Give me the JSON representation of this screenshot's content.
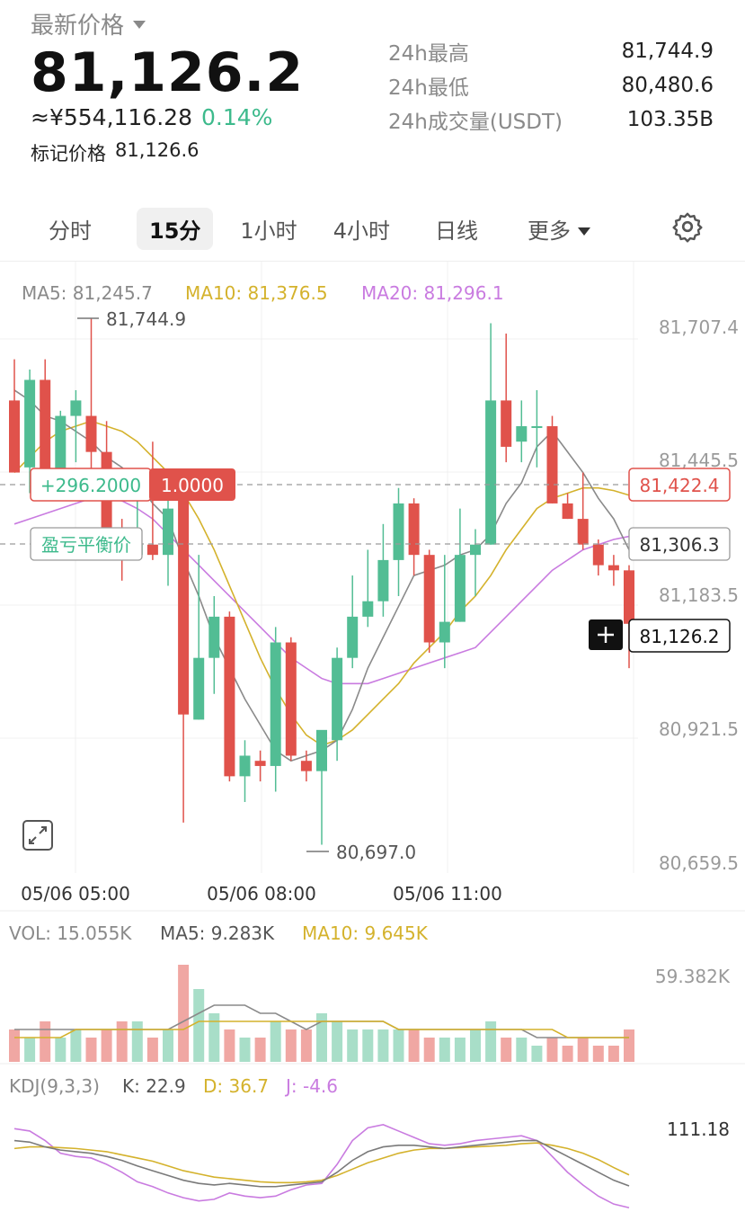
{
  "header": {
    "label": "最新价格",
    "price": "81,126.2",
    "cny_price": "≈¥554,116.28",
    "change_pct": "0.14%",
    "mark_label": "标记价格",
    "mark_value": "81,126.6"
  },
  "stats": [
    {
      "label": "24h最高",
      "value": "81,744.9"
    },
    {
      "label": "24h最低",
      "value": "80,480.6"
    },
    {
      "label": "24h成交量(USDT)",
      "value": "103.35B"
    }
  ],
  "tabs": [
    {
      "label": "分时",
      "active": false
    },
    {
      "label": "15分",
      "active": true
    },
    {
      "label": "1小时",
      "active": false
    },
    {
      "label": "4小时",
      "active": false
    },
    {
      "label": "日线",
      "active": false
    },
    {
      "label": "更多",
      "active": false
    }
  ],
  "icons": {
    "settings": "gear-icon",
    "more": "chevron-down-icon",
    "expand": "expand-icon",
    "crosshair": "plus-icon"
  },
  "colors": {
    "up": "#52bd94",
    "down": "#e0524b",
    "ma5": "#8a8a8a",
    "ma10": "#d4b22c",
    "ma20": "#c97be0"
  },
  "main_legend": {
    "ma5": "MA5: 81,245.7",
    "ma10": "MA10: 81,376.5",
    "ma20": "MA20: 81,296.1"
  },
  "price_axis": [
    "81,707.4",
    "81,445.5",
    "81,183.5",
    "80,921.5",
    "80,659.5"
  ],
  "time_axis": [
    "05/06 05:00",
    "05/06 08:00",
    "05/06 11:00"
  ],
  "annotations": {
    "high": "81,744.9",
    "low": "80,697.0",
    "position_pnl": "+296.2000",
    "position_qty": "1.0000",
    "position_price": "81,422.4",
    "breakeven_label": "盈亏平衡价",
    "breakeven_price": "81,306.3",
    "current_price": "81,126.2"
  },
  "vol_legend": {
    "vol": "VOL: 15.055K",
    "ma5": "MA5: 9.283K",
    "ma10": "MA10: 9.645K"
  },
  "vol_axis": "59.382K",
  "kdj_legend": {
    "name": "KDJ(9,3,3)",
    "k": "K: 22.9",
    "d": "D: 36.7",
    "j": "J: -4.6"
  },
  "kdj_axis": "111.18",
  "chart_data": {
    "type": "candlestick",
    "candles": [
      {
        "o": 81560,
        "h": 81640,
        "l": 81460,
        "c": 81420
      },
      {
        "o": 81430,
        "h": 81620,
        "l": 81380,
        "c": 81600
      },
      {
        "o": 81600,
        "h": 81640,
        "l": 81380,
        "c": 81400
      },
      {
        "o": 81400,
        "h": 81540,
        "l": 81370,
        "c": 81530
      },
      {
        "o": 81530,
        "h": 81580,
        "l": 81440,
        "c": 81560
      },
      {
        "o": 81530,
        "h": 81720,
        "l": 81380,
        "c": 81460
      },
      {
        "o": 81460,
        "h": 81520,
        "l": 81300,
        "c": 81310
      },
      {
        "o": 81310,
        "h": 81330,
        "l": 81210,
        "c": 81260
      },
      {
        "o": 81260,
        "h": 81390,
        "l": 81250,
        "c": 81280
      },
      {
        "o": 81280,
        "h": 81480,
        "l": 81250,
        "c": 81260
      },
      {
        "o": 81260,
        "h": 81420,
        "l": 81200,
        "c": 81350
      },
      {
        "o": 81370,
        "h": 81390,
        "l": 80740,
        "c": 80950
      },
      {
        "o": 80940,
        "h": 81260,
        "l": 80940,
        "c": 81060
      },
      {
        "o": 81060,
        "h": 81180,
        "l": 80990,
        "c": 81140
      },
      {
        "o": 81140,
        "h": 81150,
        "l": 80820,
        "c": 80830
      },
      {
        "o": 80830,
        "h": 80900,
        "l": 80780,
        "c": 80870
      },
      {
        "o": 80860,
        "h": 80880,
        "l": 80820,
        "c": 80850
      },
      {
        "o": 80850,
        "h": 81120,
        "l": 80800,
        "c": 81090
      },
      {
        "o": 81090,
        "h": 81100,
        "l": 80860,
        "c": 80870
      },
      {
        "o": 80860,
        "h": 80880,
        "l": 80820,
        "c": 80840
      },
      {
        "o": 80840,
        "h": 80900,
        "l": 80697,
        "c": 80920
      },
      {
        "o": 80900,
        "h": 81080,
        "l": 80860,
        "c": 81060
      },
      {
        "o": 81060,
        "h": 81220,
        "l": 81040,
        "c": 81140
      },
      {
        "o": 81140,
        "h": 81270,
        "l": 81120,
        "c": 81170
      },
      {
        "o": 81170,
        "h": 81320,
        "l": 81140,
        "c": 81250
      },
      {
        "o": 81250,
        "h": 81390,
        "l": 81180,
        "c": 81360
      },
      {
        "o": 81360,
        "h": 81370,
        "l": 81220,
        "c": 81260
      },
      {
        "o": 81260,
        "h": 81270,
        "l": 81070,
        "c": 81090
      },
      {
        "o": 81090,
        "h": 81260,
        "l": 81040,
        "c": 81130
      },
      {
        "o": 81130,
        "h": 81350,
        "l": 81130,
        "c": 81260
      },
      {
        "o": 81260,
        "h": 81310,
        "l": 81180,
        "c": 81280
      },
      {
        "o": 81280,
        "h": 81710,
        "l": 81280,
        "c": 81560
      },
      {
        "o": 81560,
        "h": 81690,
        "l": 81440,
        "c": 81470
      },
      {
        "o": 81480,
        "h": 81560,
        "l": 81440,
        "c": 81510
      },
      {
        "o": 81510,
        "h": 81580,
        "l": 81430,
        "c": 81510
      },
      {
        "o": 81510,
        "h": 81530,
        "l": 81360,
        "c": 81360
      },
      {
        "o": 81360,
        "h": 81380,
        "l": 81330,
        "c": 81330
      },
      {
        "o": 81330,
        "h": 81420,
        "l": 81270,
        "c": 81280
      },
      {
        "o": 81280,
        "h": 81290,
        "l": 81220,
        "c": 81240
      },
      {
        "o": 81240,
        "h": 81260,
        "l": 81200,
        "c": 81230
      },
      {
        "o": 81230,
        "h": 81240,
        "l": 81040,
        "c": 81126.2
      }
    ],
    "ma5": [
      81580,
      81560,
      81530,
      81520,
      81500,
      81480,
      81450,
      81430,
      81400,
      81360,
      81330,
      81250,
      81180,
      81100,
      81040,
      80980,
      80930,
      80880,
      80860,
      80870,
      80880,
      80900,
      80960,
      81040,
      81100,
      81160,
      81220,
      81230,
      81240,
      81260,
      81270,
      81300,
      81360,
      81400,
      81470,
      81500,
      81460,
      81420,
      81370,
      81330,
      81270
    ],
    "ma10": [
      81420,
      81450,
      81480,
      81500,
      81510,
      81520,
      81510,
      81500,
      81480,
      81450,
      81420,
      81380,
      81330,
      81270,
      81200,
      81130,
      81060,
      81000,
      80950,
      80910,
      80890,
      80900,
      80920,
      80950,
      80980,
      81010,
      81050,
      81080,
      81110,
      81150,
      81180,
      81220,
      81270,
      81310,
      81350,
      81370,
      81380,
      81390,
      81390,
      81385,
      81376
    ],
    "ma20": [
      81320,
      81330,
      81340,
      81350,
      81360,
      81370,
      81370,
      81365,
      81350,
      81330,
      81300,
      81270,
      81240,
      81210,
      81180,
      81150,
      81120,
      81090,
      81060,
      81040,
      81020,
      81010,
      81010,
      81010,
      81020,
      81030,
      81040,
      81050,
      81060,
      81070,
      81080,
      81110,
      81140,
      81170,
      81200,
      81230,
      81250,
      81270,
      81280,
      81290,
      81296
    ],
    "volume": [
      4,
      3,
      5,
      3,
      4,
      3,
      4,
      5,
      5,
      3,
      4,
      12,
      9,
      6,
      4,
      3,
      3,
      5,
      4,
      4,
      6,
      5,
      4,
      4,
      4,
      4,
      4,
      3,
      3,
      3,
      4,
      5,
      3,
      3,
      2,
      3,
      2,
      3,
      2,
      2,
      4
    ],
    "vol_ma5": [
      4,
      4,
      4,
      4,
      4,
      4,
      4,
      4,
      4,
      4,
      4,
      5,
      6,
      7,
      7,
      7,
      6,
      6,
      5,
      4,
      5,
      5,
      5,
      5,
      5,
      4,
      4,
      4,
      4,
      4,
      4,
      4,
      4,
      4,
      3,
      3,
      3,
      3,
      3,
      3,
      3
    ],
    "vol_ma10": [
      3,
      3,
      3,
      3,
      4,
      4,
      4,
      4,
      4,
      4,
      4,
      4,
      5,
      5,
      5,
      5,
      5,
      5,
      5,
      5,
      5,
      5,
      5,
      5,
      5,
      4,
      4,
      4,
      4,
      4,
      4,
      4,
      4,
      4,
      4,
      4,
      3,
      3,
      3,
      3,
      3
    ],
    "kdj_k": [
      80,
      78,
      72,
      68,
      66,
      64,
      60,
      55,
      48,
      42,
      36,
      30,
      26,
      24,
      26,
      24,
      22,
      22,
      24,
      26,
      28,
      40,
      55,
      66,
      72,
      74,
      74,
      72,
      70,
      72,
      74,
      76,
      78,
      80,
      80,
      70,
      60,
      50,
      40,
      30,
      22.9
    ],
    "kdj_d": [
      70,
      72,
      72,
      71,
      70,
      68,
      66,
      62,
      58,
      54,
      48,
      42,
      38,
      34,
      32,
      30,
      28,
      27,
      27,
      28,
      30,
      36,
      44,
      52,
      58,
      64,
      68,
      70,
      70,
      71,
      72,
      73,
      74,
      76,
      77,
      74,
      70,
      64,
      56,
      46,
      36.7
    ],
    "kdj_j": [
      95,
      92,
      80,
      64,
      60,
      58,
      50,
      40,
      28,
      22,
      14,
      8,
      4,
      6,
      14,
      10,
      8,
      10,
      18,
      24,
      26,
      50,
      80,
      96,
      100,
      92,
      84,
      76,
      74,
      76,
      80,
      82,
      84,
      86,
      80,
      60,
      40,
      24,
      10,
      0,
      -4.6
    ],
    "price_range": [
      80659.5,
      81707.4
    ],
    "grid": true
  }
}
